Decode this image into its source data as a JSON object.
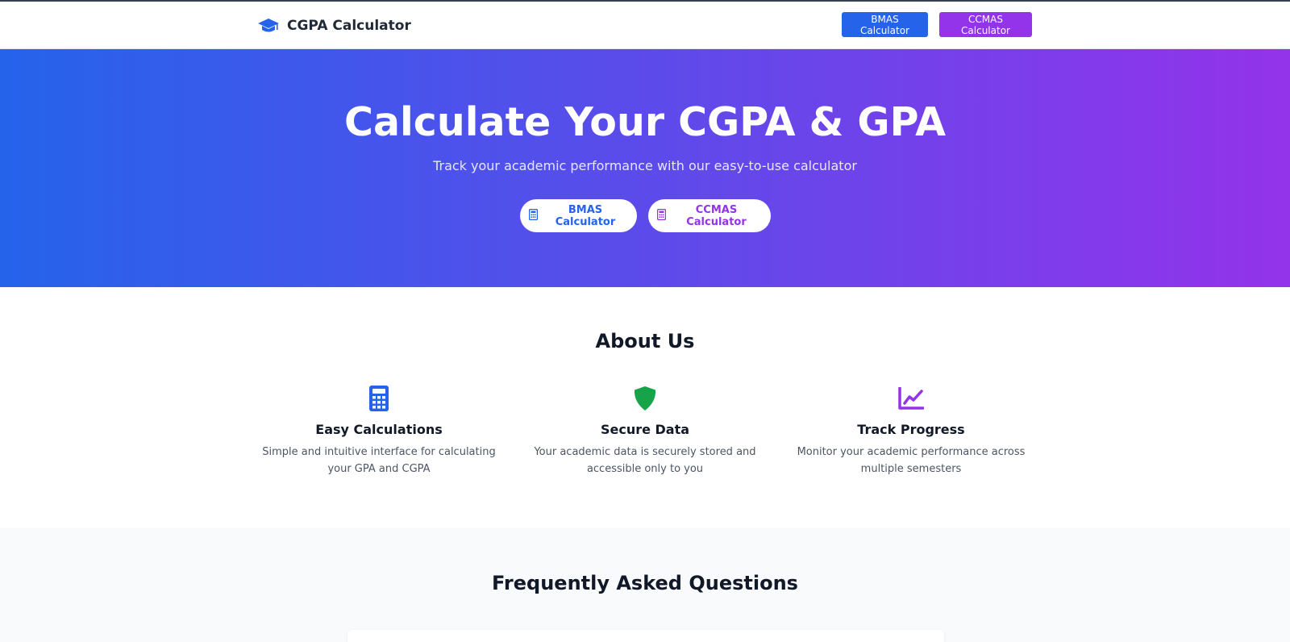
{
  "brand": {
    "title": "CGPA Calculator",
    "icon": "graduation-cap-icon"
  },
  "nav": {
    "bmas_label": "BMAS Calculator",
    "ccmas_label": "CCMAS Calculator"
  },
  "hero": {
    "title": "Calculate Your CGPA & GPA",
    "subtitle": "Track your academic performance with our easy-to-use calculator",
    "bmas_label": "BMAS Calculator",
    "ccmas_label": "CCMAS Calculator"
  },
  "about": {
    "title": "About Us",
    "features": [
      {
        "icon": "calculator-icon",
        "title": "Easy Calculations",
        "desc": "Simple and intuitive interface for calculating your GPA and CGPA"
      },
      {
        "icon": "shield-icon",
        "title": "Secure Data",
        "desc": "Your academic data is securely stored and accessible only to you"
      },
      {
        "icon": "chart-line-icon",
        "title": "Track Progress",
        "desc": "Monitor your academic performance across multiple semesters"
      }
    ]
  },
  "faq": {
    "title": "Frequently Asked Questions"
  },
  "colors": {
    "blue": "#2563eb",
    "purple": "#9333ea",
    "green": "#16a34a",
    "navy": "#1e3a8a"
  }
}
